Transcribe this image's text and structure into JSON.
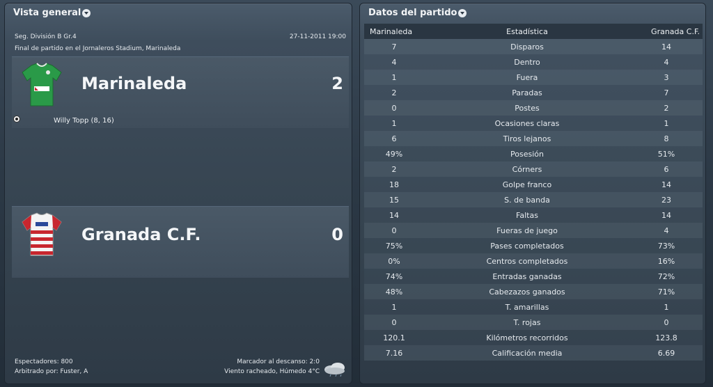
{
  "overview": {
    "title": "Vista general",
    "competition": "Seg. División B Gr.4",
    "datetime": "27-11-2011 19:00",
    "venue_line": "Final de partido en el Jornaleros Stadium, Marinaleda",
    "home": {
      "name": "Marinaleda",
      "score": "2",
      "scorer": "Willy Topp (8, 16)"
    },
    "away": {
      "name": "Granada C.F.",
      "score": "0"
    },
    "attendance": "Espectadores: 800",
    "referee": "Arbitrado por: Fuster, A",
    "halftime": "Marcador al descanso: 2:0",
    "weather": "Viento racheado, Húmedo 4°C"
  },
  "stats": {
    "title": "Datos del partido",
    "header": {
      "home": "Marinaleda",
      "stat": "Estadística",
      "away": "Granada C.F."
    },
    "rows": [
      {
        "home": "7",
        "stat": "Disparos",
        "away": "14"
      },
      {
        "home": "4",
        "stat": "Dentro",
        "away": "4"
      },
      {
        "home": "1",
        "stat": "Fuera",
        "away": "3"
      },
      {
        "home": "2",
        "stat": "Paradas",
        "away": "7"
      },
      {
        "home": "0",
        "stat": "Postes",
        "away": "2"
      },
      {
        "home": "1",
        "stat": "Ocasiones claras",
        "away": "1"
      },
      {
        "home": "6",
        "stat": "Tiros lejanos",
        "away": "8"
      },
      {
        "home": "49%",
        "stat": "Posesión",
        "away": "51%"
      },
      {
        "home": "2",
        "stat": "Córners",
        "away": "6"
      },
      {
        "home": "18",
        "stat": "Golpe franco",
        "away": "14"
      },
      {
        "home": "15",
        "stat": "S. de banda",
        "away": "23"
      },
      {
        "home": "14",
        "stat": "Faltas",
        "away": "14"
      },
      {
        "home": "0",
        "stat": "Fueras de juego",
        "away": "4"
      },
      {
        "home": "75%",
        "stat": "Pases completados",
        "away": "73%"
      },
      {
        "home": "0%",
        "stat": "Centros completados",
        "away": "16%"
      },
      {
        "home": "74%",
        "stat": "Entradas ganadas",
        "away": "72%"
      },
      {
        "home": "48%",
        "stat": "Cabezazos ganados",
        "away": "71%"
      },
      {
        "home": "1",
        "stat": "T. amarillas",
        "away": "1"
      },
      {
        "home": "0",
        "stat": "T. rojas",
        "away": "0"
      },
      {
        "home": "120.1",
        "stat": "Kilómetros recorridos",
        "away": "123.8"
      },
      {
        "home": "7.16",
        "stat": "Calificación media",
        "away": "6.69"
      }
    ]
  },
  "colors": {
    "home_shirt": "#2a9a48",
    "away_shirt_stripe": "#c8262e"
  },
  "icons": [
    "dropdown-icon",
    "ball-icon",
    "weather-cloud-icon"
  ]
}
